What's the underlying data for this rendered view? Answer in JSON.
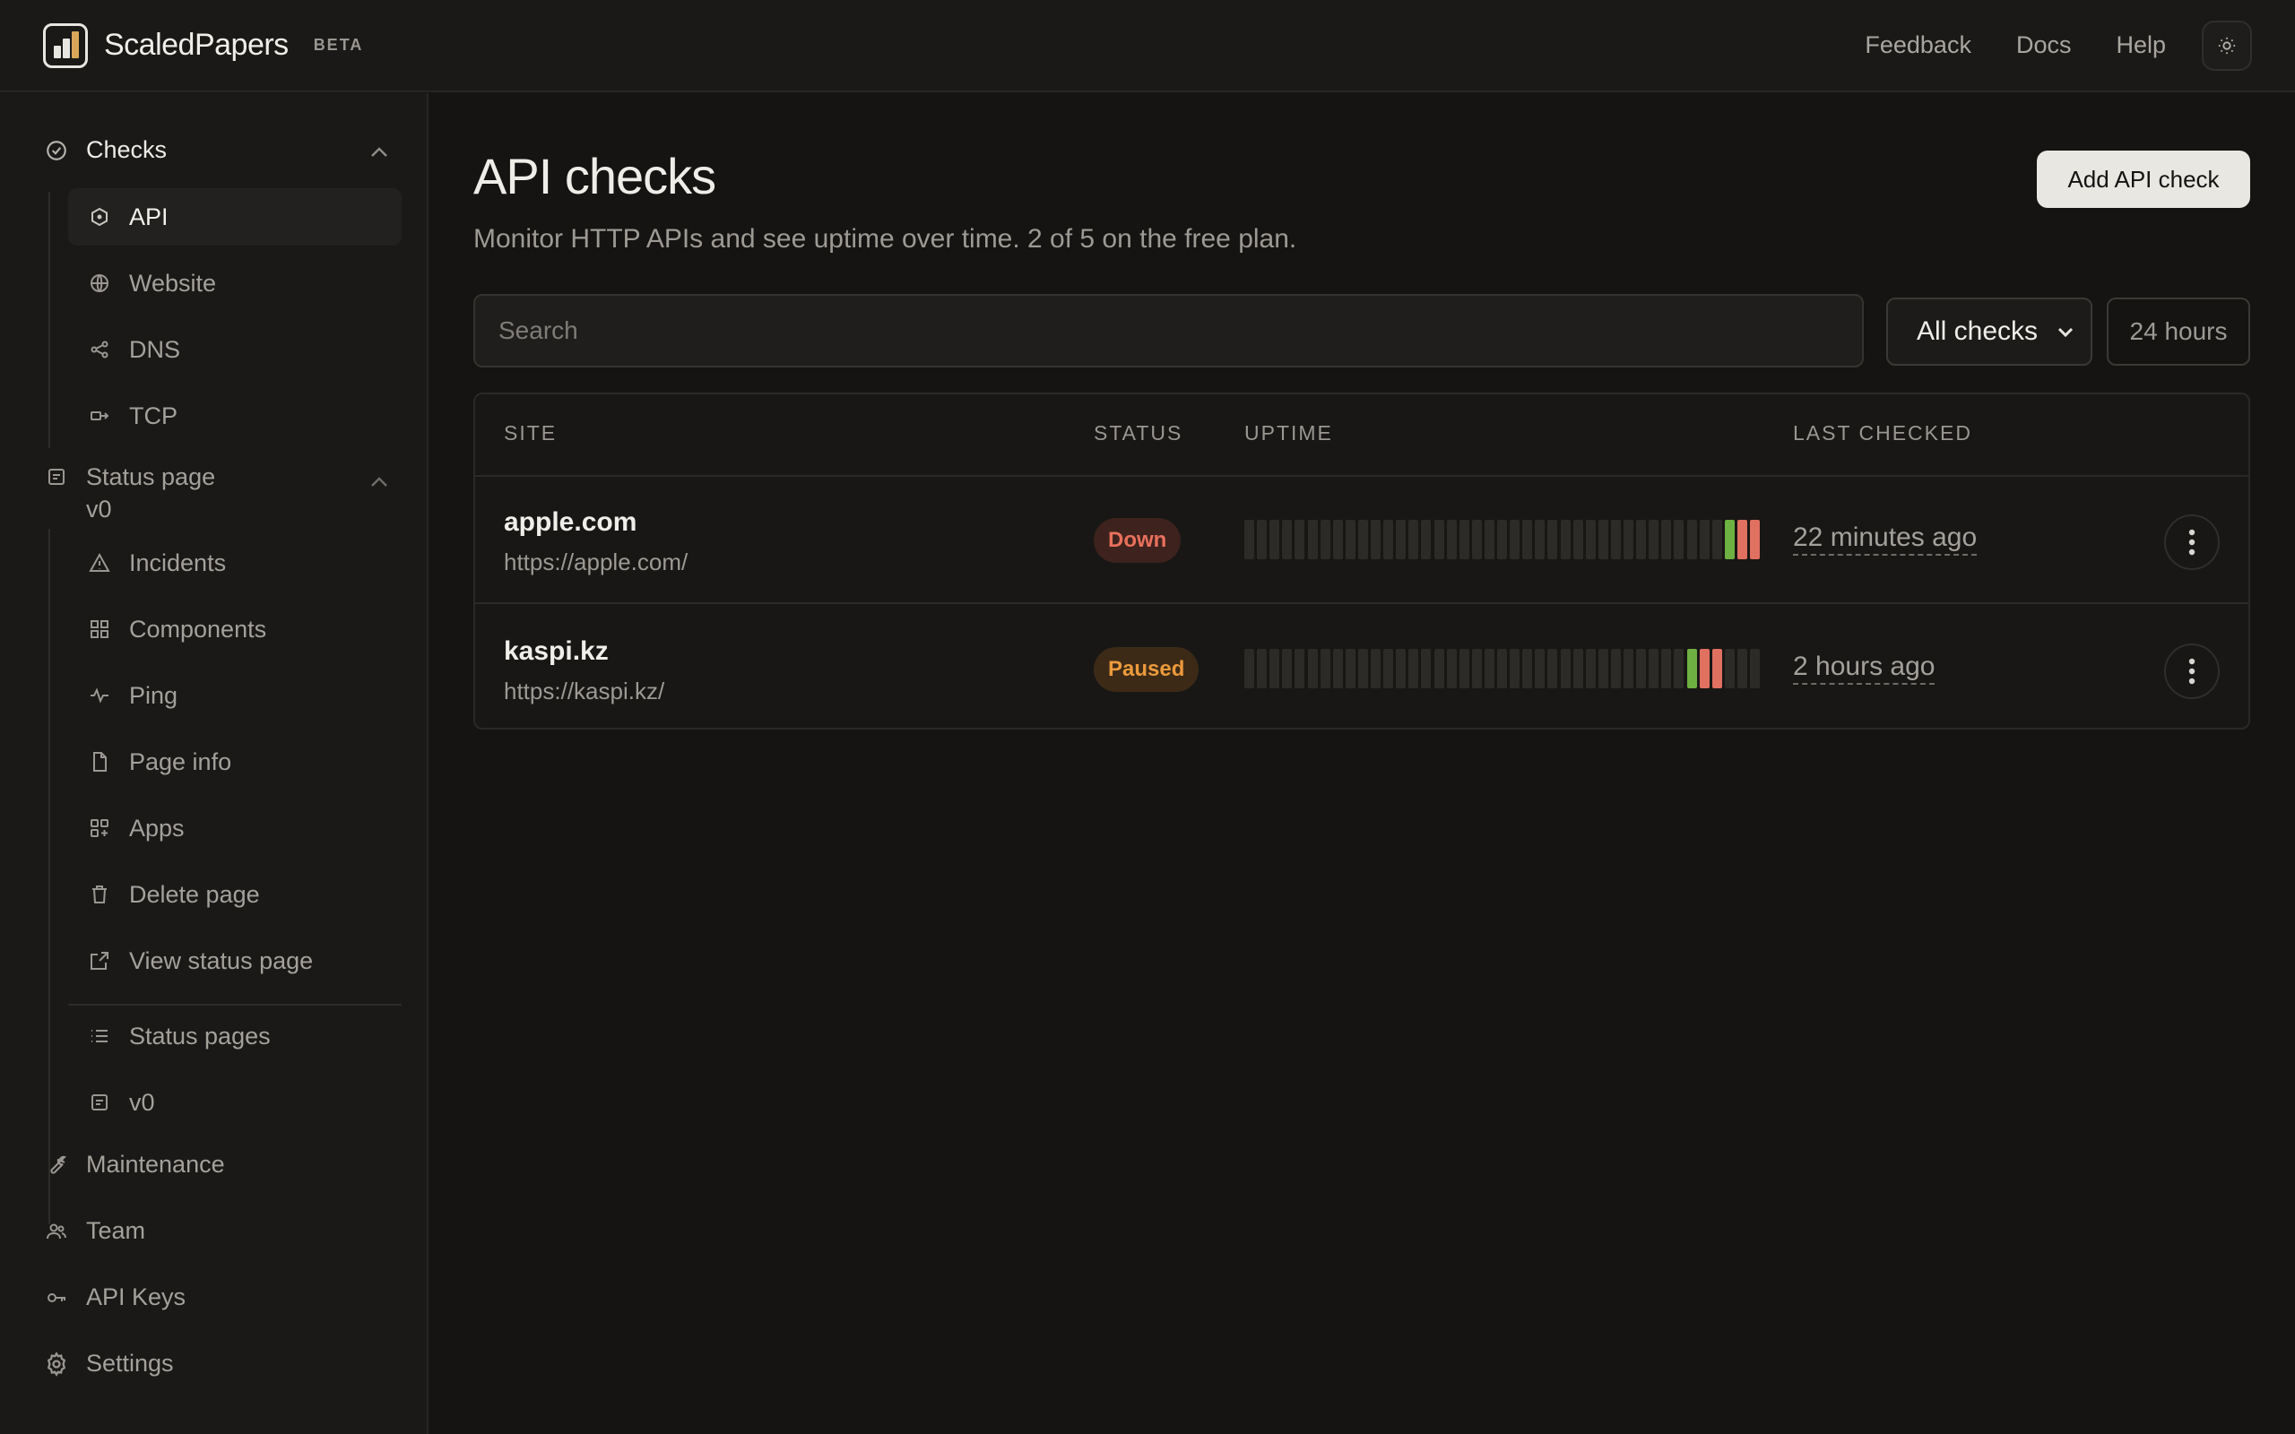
{
  "app": {
    "name": "ScaledPapers",
    "badge": "BETA"
  },
  "header": {
    "nav": [
      "Feedback",
      "Docs",
      "Help"
    ],
    "theme_icon": "sun-icon"
  },
  "sidebar": {
    "checks": {
      "label": "Checks",
      "items": [
        {
          "label": "API",
          "icon": "hexagon-icon",
          "active": true
        },
        {
          "label": "Website",
          "icon": "globe-icon",
          "active": false
        },
        {
          "label": "DNS",
          "icon": "share-icon",
          "active": false
        },
        {
          "label": "TCP",
          "icon": "plug-icon",
          "active": false
        }
      ]
    },
    "status_page": {
      "label_line1": "Status page",
      "label_line2": "v0",
      "items": [
        {
          "label": "Incidents",
          "icon": "alert-triangle-icon"
        },
        {
          "label": "Components",
          "icon": "grid-icon"
        },
        {
          "label": "Ping",
          "icon": "activity-icon"
        },
        {
          "label": "Page info",
          "icon": "file-icon"
        },
        {
          "label": "Apps",
          "icon": "apps-icon"
        },
        {
          "label": "Delete page",
          "icon": "trash-icon"
        },
        {
          "label": "View status page",
          "icon": "external-link-icon"
        }
      ],
      "sub_items": [
        {
          "label": "Status pages",
          "icon": "list-icon"
        },
        {
          "label": "v0",
          "icon": "page-icon"
        }
      ]
    },
    "bottom": [
      {
        "label": "Maintenance",
        "icon": "wrench-icon"
      },
      {
        "label": "Team",
        "icon": "users-icon"
      },
      {
        "label": "API Keys",
        "icon": "key-icon"
      },
      {
        "label": "Settings",
        "icon": "gear-icon"
      }
    ]
  },
  "main": {
    "title": "API checks",
    "subtitle": "Monitor HTTP APIs and see uptime over time. 2 of 5 on the free plan.",
    "add_button": "Add API check",
    "search_placeholder": "Search",
    "filter_value": "All checks",
    "range_value": "24 hours",
    "columns": [
      "SITE",
      "STATUS",
      "UPTIME",
      "LAST CHECKED"
    ],
    "rows": [
      {
        "name": "apple.com",
        "url": "https://apple.com/",
        "status": "Down",
        "last_checked": "22 minutes ago",
        "uptime": [
          "none",
          "none",
          "none",
          "none",
          "none",
          "none",
          "none",
          "none",
          "none",
          "none",
          "none",
          "none",
          "none",
          "none",
          "none",
          "none",
          "none",
          "none",
          "none",
          "none",
          "none",
          "none",
          "none",
          "none",
          "none",
          "none",
          "none",
          "none",
          "none",
          "none",
          "none",
          "none",
          "none",
          "none",
          "none",
          "none",
          "none",
          "none",
          "up",
          "down",
          "down"
        ]
      },
      {
        "name": "kaspi.kz",
        "url": "https://kaspi.kz/",
        "status": "Paused",
        "last_checked": "2 hours ago",
        "uptime": [
          "none",
          "none",
          "none",
          "none",
          "none",
          "none",
          "none",
          "none",
          "none",
          "none",
          "none",
          "none",
          "none",
          "none",
          "none",
          "none",
          "none",
          "none",
          "none",
          "none",
          "none",
          "none",
          "none",
          "none",
          "none",
          "none",
          "none",
          "none",
          "none",
          "none",
          "none",
          "none",
          "none",
          "none",
          "none",
          "up",
          "down",
          "down",
          "none",
          "none",
          "none"
        ]
      }
    ]
  },
  "colors": {
    "up": "#6eb041",
    "down": "#e07060",
    "none": "#2c2b28",
    "accent": "#e9e7e2"
  }
}
